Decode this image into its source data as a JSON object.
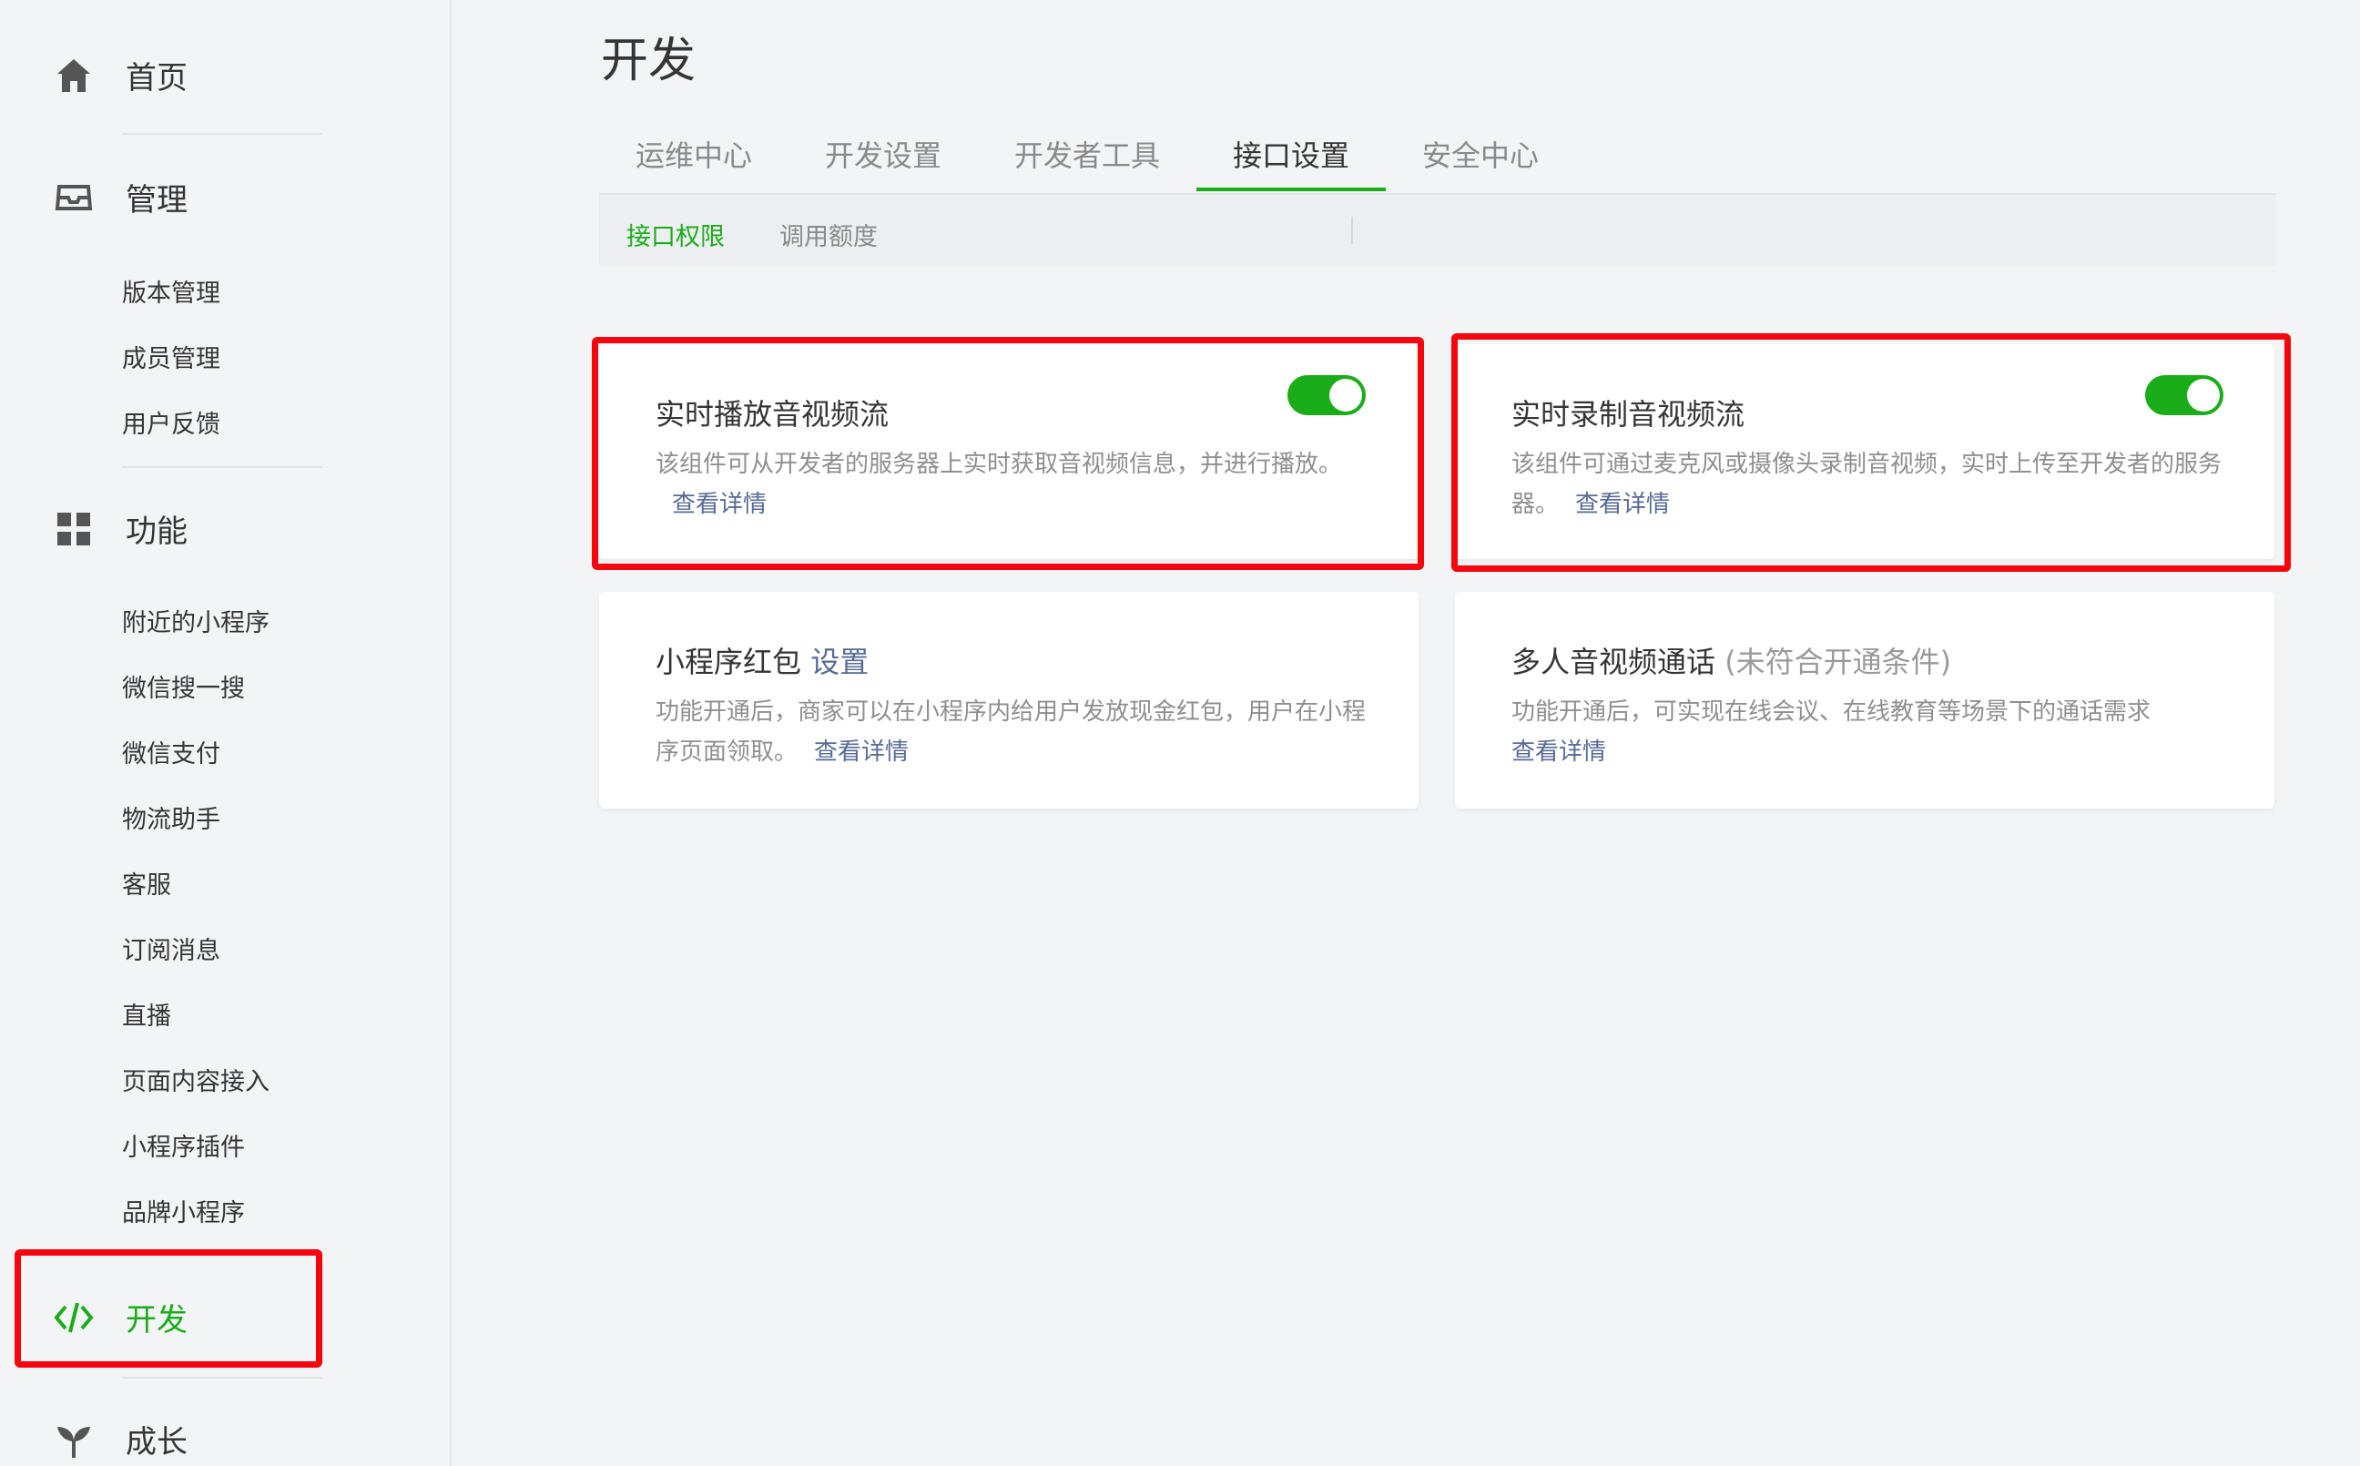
{
  "sidebar": {
    "home_label": "首页",
    "manage_label": "管理",
    "manage_items": [
      "版本管理",
      "成员管理",
      "用户反馈"
    ],
    "features_label": "功能",
    "features_items": [
      "附近的小程序",
      "微信搜一搜",
      "微信支付",
      "物流助手",
      "客服",
      "订阅消息",
      "直播",
      "页面内容接入",
      "小程序插件",
      "品牌小程序"
    ],
    "develop_label": "开发",
    "growth_label": "成长"
  },
  "main": {
    "title": "开发",
    "tabs": [
      "运维中心",
      "开发设置",
      "开发者工具",
      "接口设置",
      "安全中心"
    ],
    "active_tab": "接口设置",
    "subtabs": [
      "接口权限",
      "调用额度"
    ],
    "active_subtab": "接口权限",
    "cards": [
      {
        "title": "实时播放音视频流",
        "desc": "该组件可从开发者的服务器上实时获取音视频信息，并进行播放。",
        "link": "查看详情",
        "toggle_on": true
      },
      {
        "title": "实时录制音视频流",
        "desc": "该组件可通过麦克风或摄像头录制音视频，实时上传至开发者的服务器。",
        "link": "查看详情",
        "toggle_on": true
      },
      {
        "title": "小程序红包",
        "title_link": "设置",
        "desc": "功能开通后，商家可以在小程序内给用户发放现金红包，用户在小程序页面领取。",
        "link": "查看详情"
      },
      {
        "title": "多人音视频通话",
        "title_note": "(未符合开通条件)",
        "desc": "功能开通后，可实现在线会议、在线教育等场景下的通话需求",
        "link": "查看详情"
      }
    ]
  },
  "colors": {
    "accent_green": "#1aad19",
    "link_blue": "#576b95",
    "highlight_red": "#f5060e",
    "background": "#f3f4f6"
  }
}
